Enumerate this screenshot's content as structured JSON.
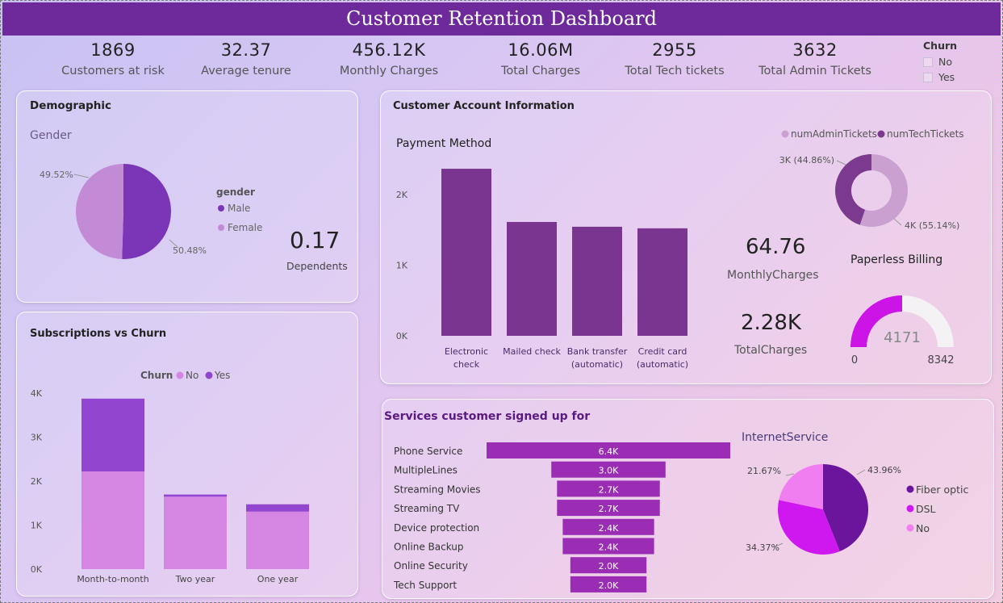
{
  "title": "Customer Retention Dashboard",
  "kpis": [
    {
      "value": "1869",
      "label": "Customers at risk"
    },
    {
      "value": "32.37",
      "label": "Average tenure"
    },
    {
      "value": "456.12K",
      "label": "Monthly Charges"
    },
    {
      "value": "16.06M",
      "label": "Total Charges"
    },
    {
      "value": "2955",
      "label": "Total Tech tickets"
    },
    {
      "value": "3632",
      "label": "Total Admin Tickets"
    }
  ],
  "churn_slicer": {
    "title": "Churn",
    "options": [
      "No",
      "Yes"
    ]
  },
  "demographic": {
    "title": "Demographic",
    "gender_title": "Gender",
    "legend_title": "gender",
    "dependents_value": "0.17",
    "dependents_label": "Dependents"
  },
  "account": {
    "title": "Customer Account Information",
    "payment_title": "Payment Method",
    "monthly_value": "64.76",
    "monthly_label": "MonthlyCharges",
    "total_value": "2.28K",
    "total_label": "TotalCharges",
    "paperless_title": "Paperless Billing",
    "gauge_min": "0",
    "gauge_max": "8342",
    "gauge_value_label": "4171"
  },
  "subscriptions": {
    "title": "Subscriptions vs Churn",
    "legend_title": "Churn"
  },
  "services": {
    "title": "Services customer signed up for",
    "internet_title": "InternetService"
  },
  "colors": {
    "title_bar": "#6e2a9a",
    "male": "#7b36b8",
    "female": "#c38bd6",
    "payment_bar": "#7a3590",
    "admin": "#c9a0d0",
    "tech": "#7b3a8e",
    "churn_no": "#d486e2",
    "churn_yes": "#9245cf",
    "service_bar": "#9a2db4",
    "fiber": "#6a159c",
    "dsl": "#cf18f0",
    "no_internet": "#f07ef0",
    "gauge_fill": "#cc14e6",
    "gauge_track": "#f4f2f5"
  },
  "chart_data": [
    {
      "type": "pie",
      "id": "gender",
      "labels": [
        "Male",
        "Female"
      ],
      "values": [
        50.48,
        49.52
      ],
      "data_labels": [
        "50.48%",
        "49.52%"
      ]
    },
    {
      "type": "bar",
      "id": "payment",
      "categories": [
        "Electronic check",
        "Mailed check",
        "Bank transfer (automatic)",
        "Credit card (automatic)"
      ],
      "category_lines": [
        [
          "Electronic",
          "check"
        ],
        [
          "Mailed check"
        ],
        [
          "Bank transfer",
          "(automatic)"
        ],
        [
          "Credit card",
          "(automatic)"
        ]
      ],
      "values": [
        2365,
        1612,
        1544,
        1522
      ],
      "ylim": [
        0,
        2400
      ],
      "yticks": [
        0,
        1000,
        2000
      ],
      "ytick_labels": [
        "0K",
        "1K",
        "2K"
      ]
    },
    {
      "type": "pie",
      "id": "tickets",
      "labels": [
        "numAdminTickets",
        "numTechTickets"
      ],
      "values": [
        55.14,
        44.86
      ],
      "data_labels": [
        "4K (55.14%)",
        "3K (44.86%)"
      ]
    },
    {
      "type": "gauge",
      "id": "paperless",
      "min": 0,
      "max": 8342,
      "value": 4171
    },
    {
      "type": "bar",
      "id": "subscriptions",
      "stacked": true,
      "categories": [
        "Month-to-month",
        "Two year",
        "One year"
      ],
      "series": [
        {
          "name": "No",
          "values": [
            2220,
            1647,
            1307
          ]
        },
        {
          "name": "Yes",
          "values": [
            1655,
            48,
            166
          ]
        }
      ],
      "ylim": [
        0,
        4000
      ],
      "yticks": [
        0,
        1000,
        2000,
        3000,
        4000
      ],
      "ytick_labels": [
        "0K",
        "1K",
        "2K",
        "3K",
        "4K"
      ]
    },
    {
      "type": "bar",
      "id": "services",
      "orientation": "funnel",
      "categories": [
        "Phone Service",
        "MultipleLines",
        "Streaming Movies",
        "Streaming TV",
        "Device protection",
        "Online Backup",
        "Online Security",
        "Tech Support"
      ],
      "values": [
        6400,
        3000,
        2700,
        2700,
        2400,
        2400,
        2000,
        2000
      ],
      "data_labels": [
        "6.4K",
        "3.0K",
        "2.7K",
        "2.7K",
        "2.4K",
        "2.4K",
        "2.0K",
        "2.0K"
      ]
    },
    {
      "type": "pie",
      "id": "internet",
      "labels": [
        "Fiber optic",
        "DSL",
        "No"
      ],
      "values": [
        43.96,
        34.37,
        21.67
      ],
      "data_labels": [
        "43.96%",
        "34.37%",
        "21.67%"
      ]
    }
  ]
}
